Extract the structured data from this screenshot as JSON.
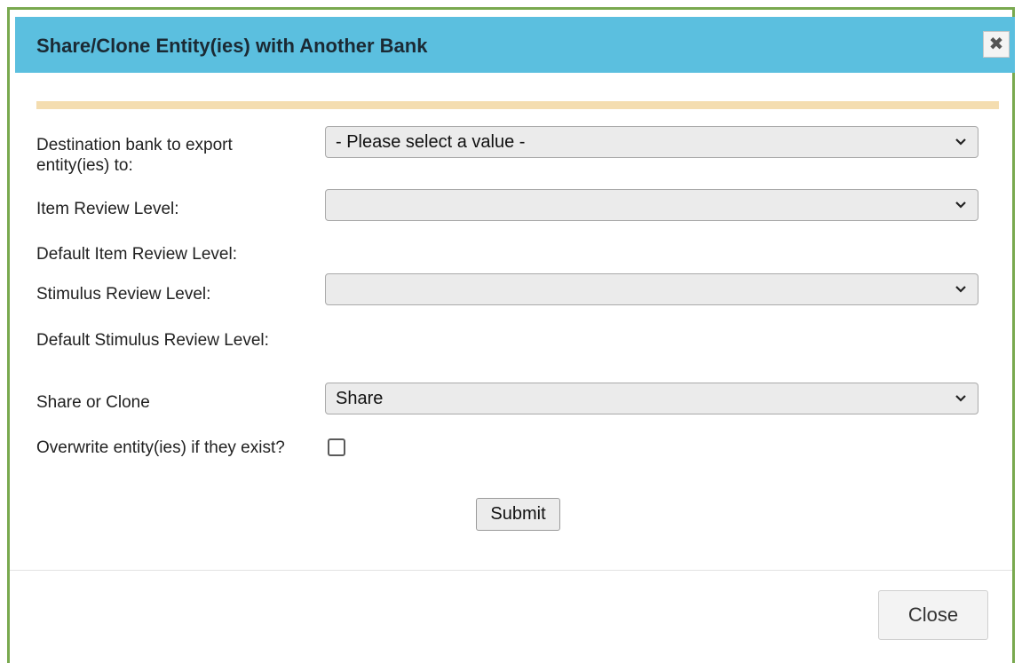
{
  "dialog": {
    "title": "Share/Clone Entity(ies) with Another Bank",
    "close_icon": "close-icon",
    "close_glyph": "✖"
  },
  "form": {
    "destination_label": "Destination bank to export entity(ies) to:",
    "destination_value": "- Please select a value -",
    "item_review_label": "Item Review Level:",
    "item_review_value": "",
    "default_item_review_label": "Default Item Review Level:",
    "stimulus_review_label": "Stimulus Review Level:",
    "stimulus_review_value": "",
    "default_stimulus_review_label": "Default Stimulus Review Level:",
    "share_clone_label": "Share or Clone",
    "share_clone_value": "Share",
    "overwrite_label": "Overwrite entity(ies) if they exist?",
    "overwrite_checked": false,
    "submit_label": "Submit"
  },
  "footer": {
    "close_label": "Close"
  },
  "colors": {
    "titlebar": "#5bbfdf",
    "dialog_border": "#79a94f",
    "divider": "#f4ddb0"
  }
}
